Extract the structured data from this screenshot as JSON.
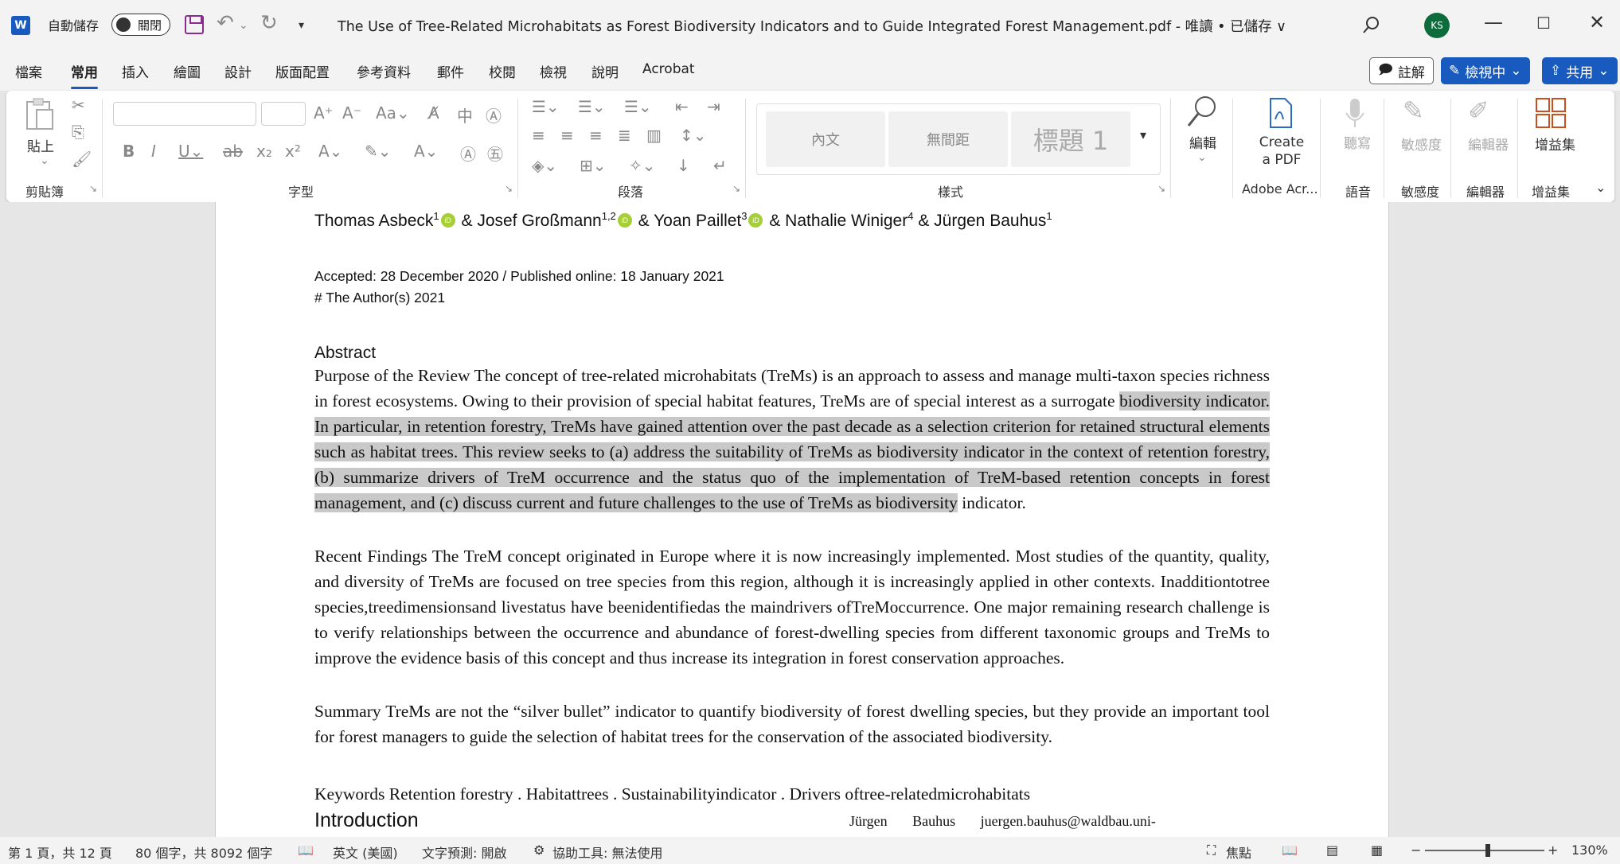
{
  "titlebar": {
    "app_icon": "W",
    "autosave_label": "自動儲存",
    "autosave_state": "關閉",
    "document_title": "The Use of Tree-Related Microhabitats as Forest Biodiversity Indicators and to Guide Integrated Forest Management.pdf  -  唯讀 • 已儲存 ∨",
    "avatar_initials": "KS"
  },
  "tabs": [
    "檔案",
    "常用",
    "插入",
    "繪圖",
    "設計",
    "版面配置",
    "參考資料",
    "郵件",
    "校閱",
    "檢視",
    "說明",
    "Acrobat"
  ],
  "active_tab": "常用",
  "actions": {
    "comment": "註解",
    "review": "檢視中",
    "share": "共用"
  },
  "ribbon": {
    "clipboard": {
      "paste": "貼上",
      "group": "剪貼簿"
    },
    "font": {
      "group": "字型"
    },
    "paragraph": {
      "group": "段落"
    },
    "styles": {
      "group": "樣式",
      "items": [
        "內文",
        "無間距",
        "標題 1"
      ]
    },
    "editing": {
      "label": "編輯"
    },
    "acrobat": {
      "label": "Create a PDF",
      "line1": "Create",
      "line2": "a PDF",
      "group": "Adobe Acr..."
    },
    "voice": {
      "label": "聽寫",
      "group": "語音"
    },
    "sensitivity": {
      "label": "敏感度",
      "group": "敏感度"
    },
    "editor": {
      "label": "編輯器",
      "group": "編輯器"
    },
    "addins": {
      "label": "增益集",
      "group": "增益集"
    }
  },
  "document": {
    "authors": {
      "a1": "Thomas Asbeck",
      "a1_sup": "1",
      "a2": "& Josef Großmann",
      "a2_sup": "1,2",
      "a3": "& Yoan Paillet",
      "a3_sup": "3",
      "a4": "& Nathalie Winiger",
      "a4_sup": "4",
      "a5": "& Jürgen Bauhus",
      "a5_sup": "1",
      "orcid": "iD"
    },
    "accepted": "Accepted: 28 December 2020 / Published online: 18 January 2021",
    "copyright": "# The Author(s) 2021",
    "abstract_heading": "Abstract",
    "purpose_pre": "Purpose of the Review The concept of tree-related microhabitats (TreMs) is an approach to assess and manage multi-taxon species richness in forest ecosystems. Owing to their provision of special habitat features, TreMs are of special interest as a surrogate ",
    "purpose_hl": "biodiversity indicator. In particular, in retention forestry, TreMs have gained attention over the past decade as a selection criterion for retained structural elements such as habitat trees. This review seeks to (a) address the suitability of TreMs as biodiversity indicator in the context of retention forestry, (b) summarize drivers of TreM occurrence and the status quo of the implementation of TreM-based retention concepts in forest management, and (c) discuss current and future challenges to the use of TreMs as biodiversity",
    "purpose_post": " indicator.",
    "findings": "Recent Findings The TreM concept originated in Europe where it is now increasingly implemented. Most studies of the quantity, quality, and diversity of TreMs are focused on tree species from this region, although it is increasingly applied in other contexts. Inadditiontotree species,treedimensionsand livestatus have beenidentifiedas the maindrivers ofTreMoccurrence. One major remaining research challenge is to verify relationships between the occurrence and abundance of forest-dwelling species from different taxonomic groups and TreMs to improve the evidence basis of this concept and thus increase its integration in forest conservation approaches.",
    "summary": "Summary TreMs are not the “silver bullet” indicator to quantify biodiversity of forest dwelling species, but they provide an important tool for forest managers to guide the selection of habitat trees for the conservation of the associated biodiversity.",
    "keywords": "Keywords Retention forestry . Habitattrees . Sustainabilityindicator . Drivers oftree-relatedmicrohabitats",
    "intro_heading": "Introduction",
    "footnote": "Jürgen       Bauhus       juergen.bauhus@waldbau.uni-"
  },
  "statusbar": {
    "page": "第 1 頁，共 12 頁",
    "words": "80 個字，共 8092 個字",
    "language": "英文 (美國)",
    "prediction": "文字預測: 開啟",
    "accessibility": "協助工具: 無法使用",
    "focus": "焦點",
    "zoom": "130%"
  },
  "colors": {
    "accent": "#185abd",
    "highlight": "#c9c9c9",
    "orcid": "#a6ce39"
  }
}
